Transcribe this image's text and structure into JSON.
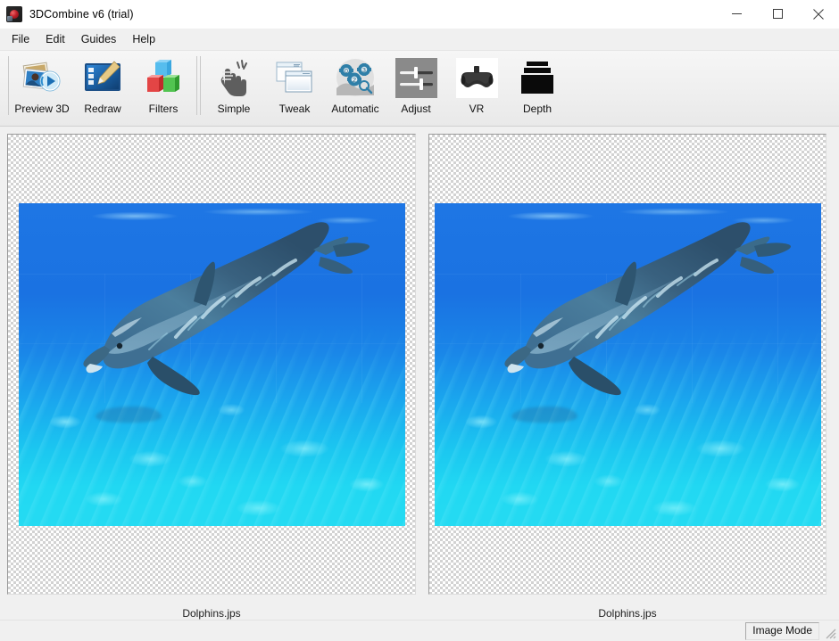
{
  "window": {
    "title": "3DCombine v6 (trial)",
    "app_icon": "app-logo-icon",
    "controls": [
      {
        "name": "minimize",
        "glyph": "minimize-icon"
      },
      {
        "name": "maximize",
        "glyph": "maximize-icon"
      },
      {
        "name": "close",
        "glyph": "close-icon"
      }
    ]
  },
  "menubar": {
    "items": [
      {
        "label": "File"
      },
      {
        "label": "Edit"
      },
      {
        "label": "Guides"
      },
      {
        "label": "Help"
      }
    ]
  },
  "toolbar": {
    "groups": [
      {
        "buttons": [
          {
            "label": "Preview 3D",
            "icon": "preview-3d-icon"
          },
          {
            "label": "Redraw",
            "icon": "redraw-icon"
          },
          {
            "label": "Filters",
            "icon": "filters-icon"
          }
        ]
      },
      {
        "buttons": [
          {
            "label": "Simple",
            "icon": "hand-click-icon"
          },
          {
            "label": "Tweak",
            "icon": "windows-stack-icon"
          },
          {
            "label": "Automatic",
            "icon": "gears-123-icon"
          },
          {
            "label": "Adjust",
            "icon": "sliders-icon"
          },
          {
            "label": "VR",
            "icon": "vr-headset-icon"
          },
          {
            "label": "Depth",
            "icon": "depth-layers-icon"
          }
        ]
      }
    ]
  },
  "main": {
    "panels": [
      {
        "name": "left-image-panel",
        "caption": "Dolphins.jps",
        "image_alt": "Dolphin swimming underwater - left eye view"
      },
      {
        "name": "right-image-panel",
        "caption": "Dolphins.jps",
        "image_alt": "Dolphin swimming underwater - right eye view"
      }
    ]
  },
  "statusbar": {
    "mode_label": "Image Mode",
    "grip": "resize-grip-icon"
  },
  "colors": {
    "window_bg": "#f0f0f0",
    "titlebar_bg": "#ffffff",
    "toolbar_bg": "#efefef",
    "accent_close": "#e81123",
    "water_top": "#1e76e4",
    "water_bottom": "#25dbf2",
    "panel_border": "#9a9a9a"
  }
}
